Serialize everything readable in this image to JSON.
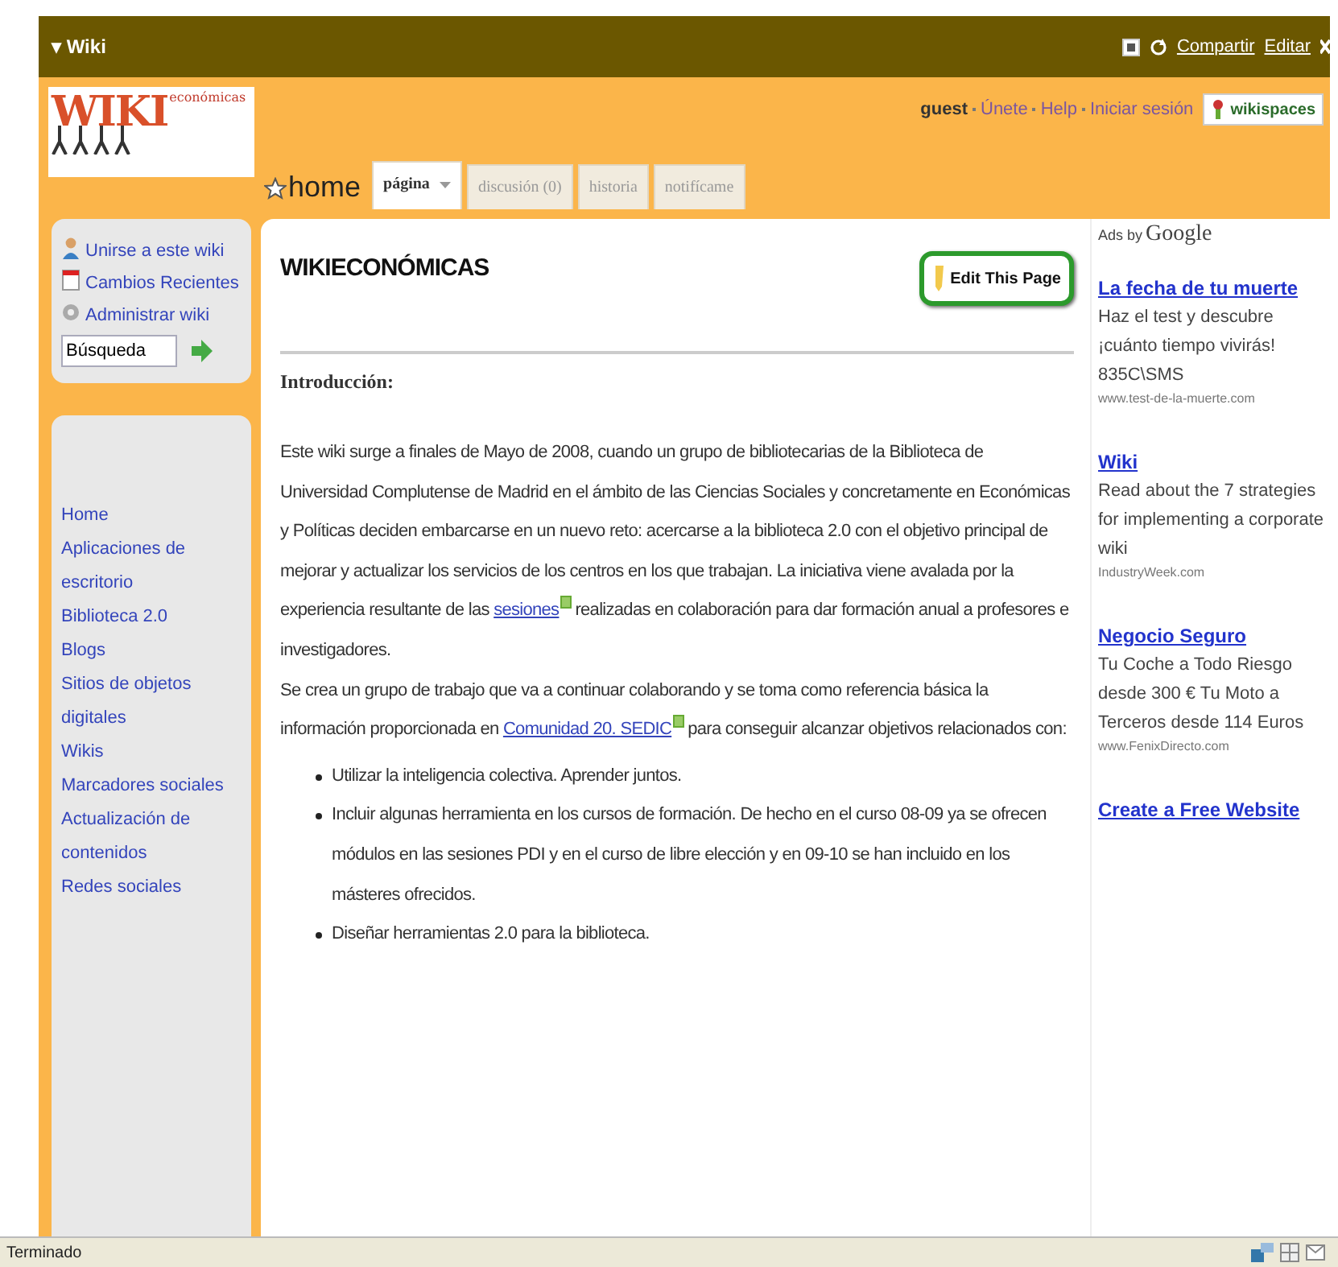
{
  "frame": {
    "title": "▾ Wiki",
    "actions": [
      {
        "label": "Compartir"
      },
      {
        "label": "Editar"
      }
    ]
  },
  "logo": {
    "big": "WIKI",
    "small": "económicas"
  },
  "user_bar": {
    "user": "guest",
    "links": [
      "Únete",
      "Help",
      "Iniciar sesión"
    ],
    "badge": "wikispaces"
  },
  "page_name": "home",
  "tabs": [
    {
      "label": "página",
      "selected": true,
      "dropdown": true
    },
    {
      "label": "discusión (0)",
      "selected": false,
      "dropdown": false
    },
    {
      "label": "historia",
      "selected": false,
      "dropdown": false
    },
    {
      "label": "notifícame",
      "selected": false,
      "dropdown": false
    }
  ],
  "sidebar": {
    "actions": [
      {
        "label": "Unirse a este wiki"
      },
      {
        "label": "Cambios Recientes"
      },
      {
        "label": "Administrar wiki"
      }
    ],
    "search": {
      "value": "Búsqueda"
    },
    "nav": [
      "Home",
      "Aplicaciones de escritorio",
      "Biblioteca 2.0",
      "Blogs",
      "Sitios de objetos digitales",
      "Wikis",
      "Marcadores sociales",
      "Actualización de contenidos",
      "Redes sociales"
    ]
  },
  "content": {
    "title": "WIKIECONÓMICAS",
    "edit_button": "Edit This Page",
    "heading": "Introducción:",
    "paragraphs": [
      {
        "before": "Este wiki surge a finales de Mayo de 2008, cuando un grupo de bibliotecarias de la Biblioteca de Universidad Complutense de Madrid en el ámbito de las Ciencias Sociales y concretamente en Económicas y Políticas deciden embarcarse en un nuevo reto: acercarse a la biblioteca 2.0 con el objetivo principal de mejorar y actualizar los servicios de los centros en los que trabajan. La iniciativa viene avalada por la experiencia resultante de las",
        "link": "sesiones",
        "after": "realizadas en colaboración para dar formación anual a profesores e investigadores."
      },
      {
        "before": "Se crea un grupo de trabajo que va a continuar colaborando y se toma como referencia básica la información proporcionada en",
        "link": "Comunidad 20. SEDIC",
        "after": "para conseguir alcanzar objetivos relacionados con:"
      }
    ],
    "bullets": [
      "Utilizar la inteligencia colectiva. Aprender juntos.",
      "Incluir algunas herramienta en los cursos de formación. De hecho en el curso 08-09 ya se ofrecen módulos en las sesiones PDI y en el curso de libre elección y en 09-10 se han incluido en los másteres ofrecidos.",
      "Diseñar herramientas 2.0 para la biblioteca."
    ]
  },
  "ads": {
    "label_small": "Ads by",
    "label_brand": "Google",
    "items": [
      {
        "title": "La fecha de tu muerte",
        "text": "Haz el test y descubre ¡cuánto tiempo vivirás! 835C\\SMS",
        "url": "www.test-de-la-muerte.com"
      },
      {
        "title": "Wiki",
        "text": "Read about the 7 strategies for implementing a corporate wiki",
        "url": "IndustryWeek.com"
      },
      {
        "title": "Negocio Seguro",
        "text": "Tu Coche a Todo Riesgo desde 300 € Tu Moto a Terceros desde 114 Euros",
        "url": "www.FenixDirecto.com"
      },
      {
        "title": "Create a Free Website"
      }
    ]
  },
  "status_bar": {
    "text": "Terminado"
  }
}
